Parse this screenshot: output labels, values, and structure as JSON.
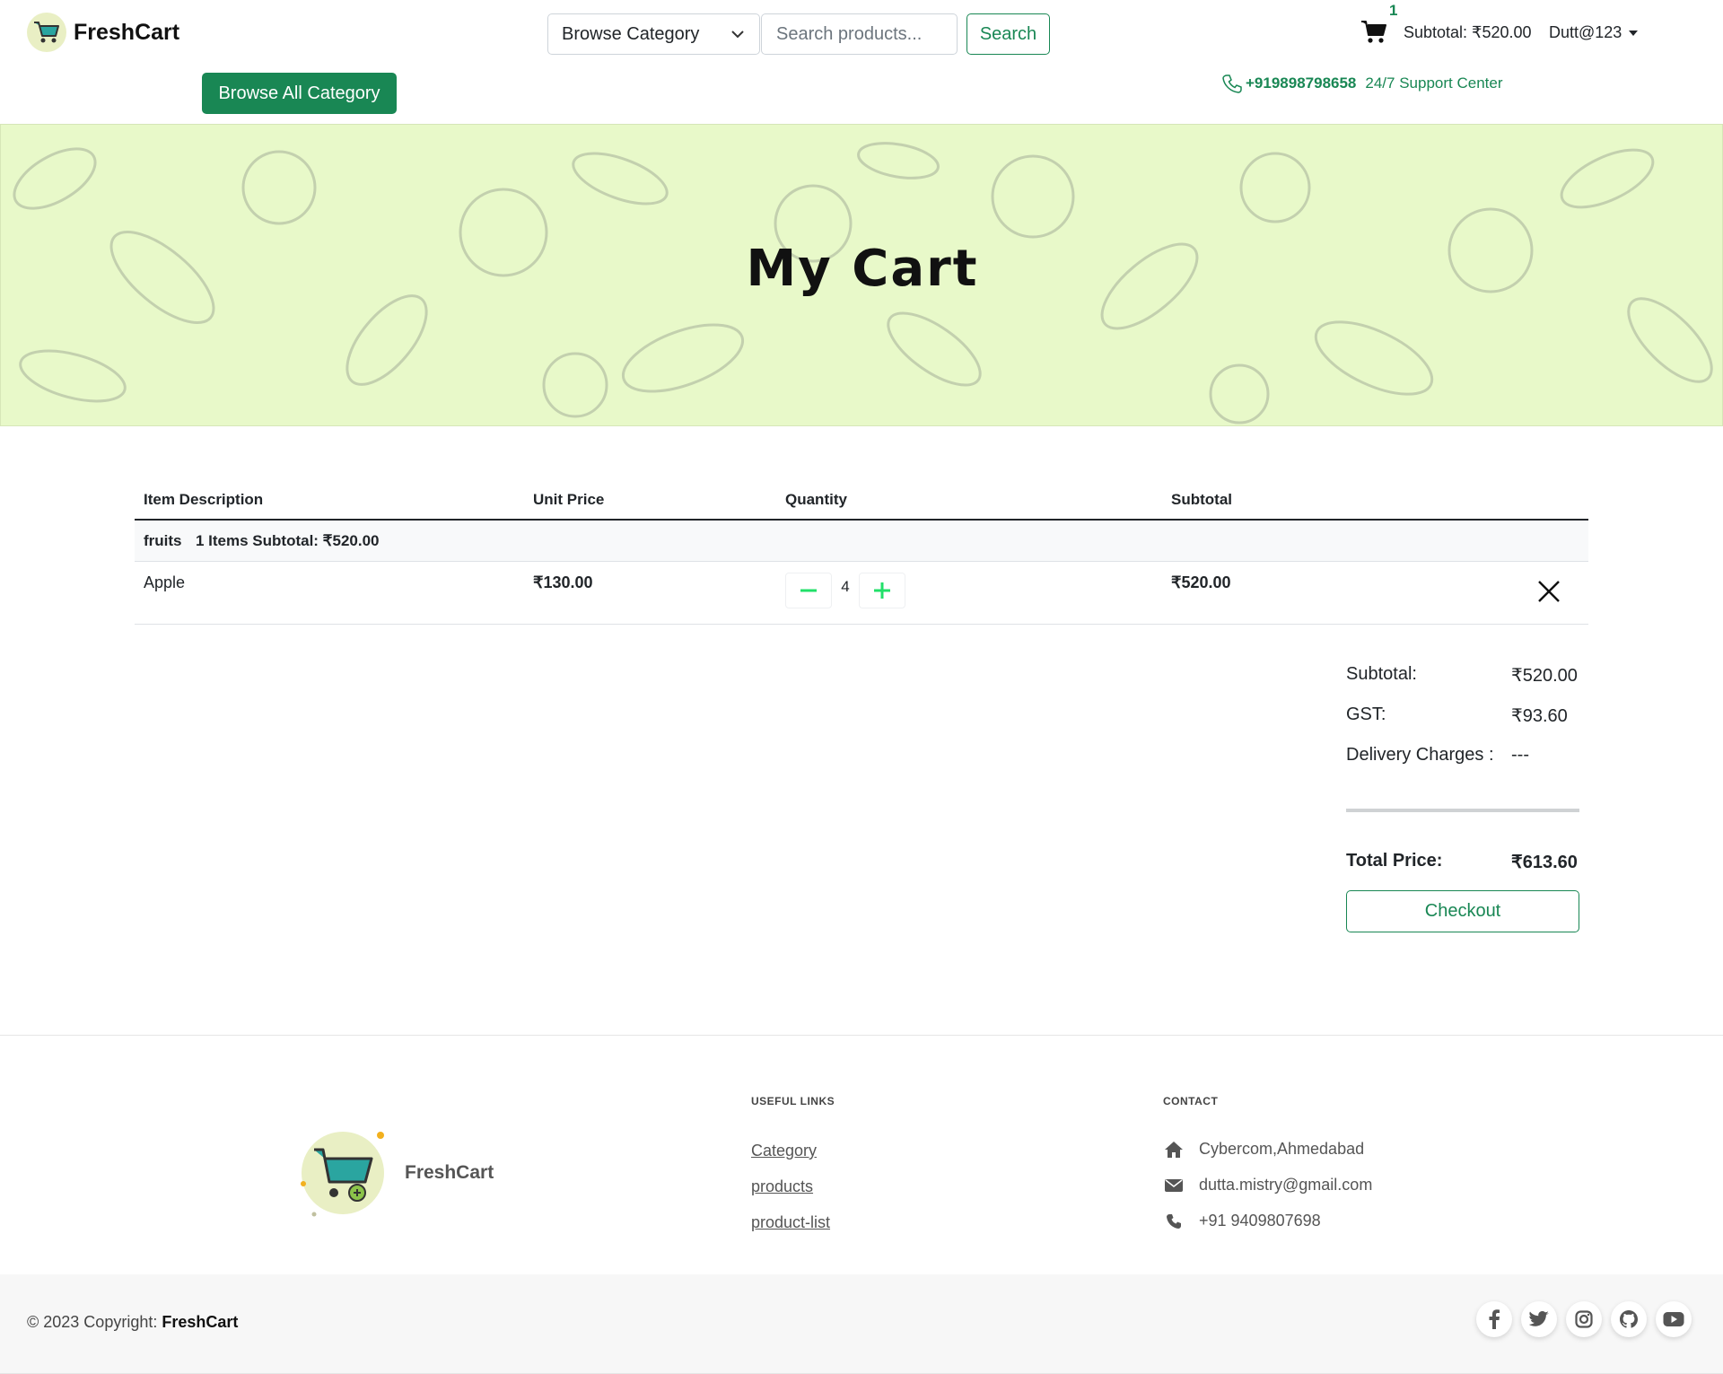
{
  "brand": {
    "name": "FreshCart"
  },
  "header": {
    "category_select": "Browse Category",
    "search_placeholder": "Search products...",
    "search_button": "Search",
    "cart_count": "1",
    "subtotal": "Subtotal: ₹520.00",
    "user": "Dutt@123",
    "browse_all": "Browse All Category",
    "support_phone": "+919898798658",
    "support_text": "24/7 Support Center"
  },
  "banner": {
    "title": "My Cart"
  },
  "cart": {
    "columns": [
      "Item Description",
      "Unit Price",
      "Quantity",
      "Subtotal"
    ],
    "groups": [
      {
        "name": "fruits",
        "summary": "1 Items Subtotal: ₹520.00",
        "items": [
          {
            "name": "Apple",
            "unit_price": "₹130.00",
            "quantity": "4",
            "subtotal": "₹520.00"
          }
        ]
      }
    ]
  },
  "summary": {
    "subtotal_label": "Subtotal:",
    "subtotal": "₹520.00",
    "gst_label": "GST:",
    "gst": "₹93.60",
    "delivery_label": "Delivery Charges :",
    "delivery": "---",
    "total_label": "Total Price:",
    "total": "₹613.60",
    "checkout": "Checkout"
  },
  "footer": {
    "brand": "FreshCart",
    "useful_links_heading": "USEFUL LINKS",
    "links": [
      "Category",
      "products",
      "product-list"
    ],
    "contact_heading": "CONTACT",
    "contact": {
      "address": "Cybercom,Ahmedabad",
      "email": "dutta.mistry@gmail.com",
      "phone": "+91 9409807698"
    },
    "copyright_prefix": "© 2023 Copyright:",
    "copyright_brand": "FreshCart",
    "social_icons": [
      "facebook-icon",
      "twitter-icon",
      "instagram-icon",
      "github-icon",
      "youtube-icon"
    ]
  },
  "colors": {
    "primary": "#198754",
    "banner_bg": "#e8f9c9",
    "qty_button": "#22e06a"
  }
}
